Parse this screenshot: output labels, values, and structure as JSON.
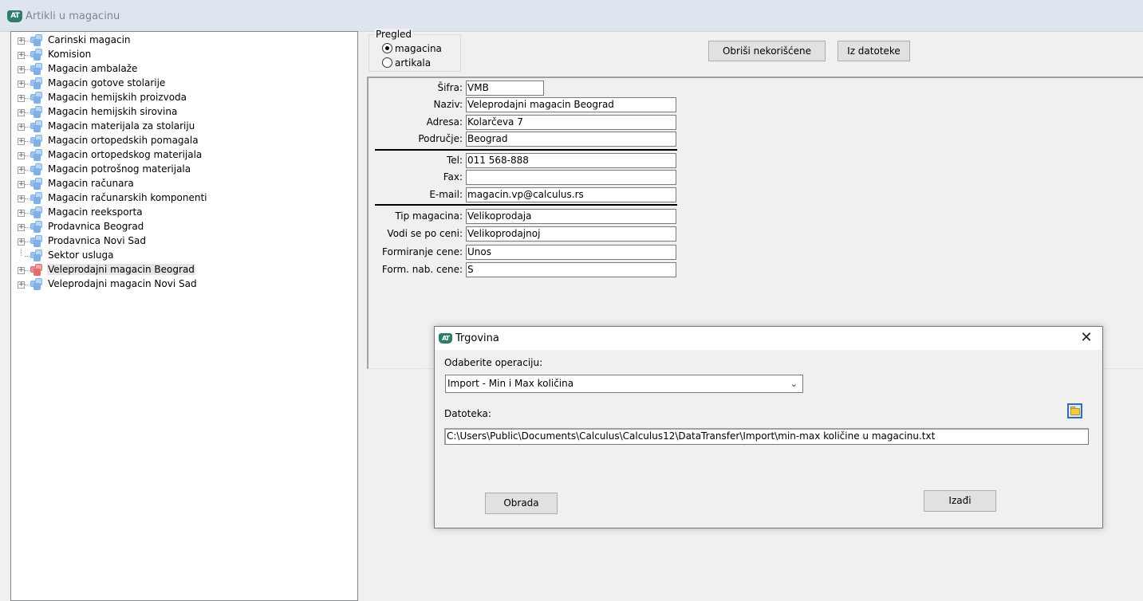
{
  "window": {
    "title": "Artikli u magacinu",
    "logo_text": "AT",
    "accent_color": "#2d7d68"
  },
  "tree": {
    "items": [
      {
        "label": "Carinski magacin",
        "expandable": true,
        "color": "blue"
      },
      {
        "label": "Komision",
        "expandable": true,
        "color": "blue"
      },
      {
        "label": "Magacin ambalaže",
        "expandable": true,
        "color": "blue"
      },
      {
        "label": "Magacin gotove stolarije",
        "expandable": true,
        "color": "blue"
      },
      {
        "label": "Magacin hemijskih proizvoda",
        "expandable": true,
        "color": "blue"
      },
      {
        "label": "Magacin hemijskih sirovina",
        "expandable": true,
        "color": "blue"
      },
      {
        "label": "Magacin materijala za stolariju",
        "expandable": true,
        "color": "blue"
      },
      {
        "label": "Magacin ortopedskih pomagala",
        "expandable": true,
        "color": "blue"
      },
      {
        "label": "Magacin ortopedskog materijala",
        "expandable": true,
        "color": "blue"
      },
      {
        "label": "Magacin potrošnog materijala",
        "expandable": true,
        "color": "blue"
      },
      {
        "label": "Magacin računara",
        "expandable": true,
        "color": "blue"
      },
      {
        "label": "Magacin računarskih komponenti",
        "expandable": true,
        "color": "blue"
      },
      {
        "label": "Magacin reeksporta",
        "expandable": true,
        "color": "blue"
      },
      {
        "label": "Prodavnica Beograd",
        "expandable": true,
        "color": "blue"
      },
      {
        "label": "Prodavnica Novi Sad",
        "expandable": true,
        "color": "blue"
      },
      {
        "label": "Sektor usluga",
        "expandable": false,
        "color": "blue"
      },
      {
        "label": "Veleprodajni magacin Beograd",
        "expandable": true,
        "color": "red",
        "selected": true
      },
      {
        "label": "Veleprodajni magacin Novi Sad",
        "expandable": true,
        "color": "blue"
      }
    ]
  },
  "pregled": {
    "title": "Pregled",
    "options": [
      {
        "label": "magacina",
        "checked": true
      },
      {
        "label": "artikala",
        "checked": false
      }
    ]
  },
  "toolbar": {
    "delete_unused_label": "Obriši nekorišćene",
    "from_file_label": "Iz datoteke"
  },
  "form": {
    "sifra": {
      "label": "Šifra:",
      "value": "VMB"
    },
    "naziv": {
      "label": "Naziv:",
      "value": "Veleprodajni magacin Beograd"
    },
    "adresa": {
      "label": "Adresa:",
      "value": "Kolarčeva 7"
    },
    "podrucje": {
      "label": "Područje:",
      "value": "Beograd"
    },
    "tel": {
      "label": "Tel:",
      "value": "011 568-888"
    },
    "fax": {
      "label": "Fax:",
      "value": ""
    },
    "email": {
      "label": "E-mail:",
      "value": "magacin.vp@calculus.rs"
    },
    "tip": {
      "label": "Tip magacina:",
      "value": "Velikoprodaja"
    },
    "vodi": {
      "label": "Vodi se po ceni:",
      "value": "Velikoprodajnoj"
    },
    "formiranje": {
      "label": "Formiranje cene:",
      "value": "Unos"
    },
    "form_nab": {
      "label": "Form. nab. cene:",
      "value": "S"
    }
  },
  "dialog": {
    "title": "Trgovina",
    "close_glyph": "✕",
    "operation_label": "Odaberite operaciju:",
    "operation_value": "Import - Min i Max količina",
    "file_label": "Datoteka:",
    "file_path": "C:\\Users\\Public\\Documents\\Calculus\\Calculus12\\DataTransfer\\Import\\min-max količine u magacinu.txt",
    "process_label": "Obrada",
    "exit_label": "Izađi",
    "folder_icon": "folder-open-icon"
  }
}
